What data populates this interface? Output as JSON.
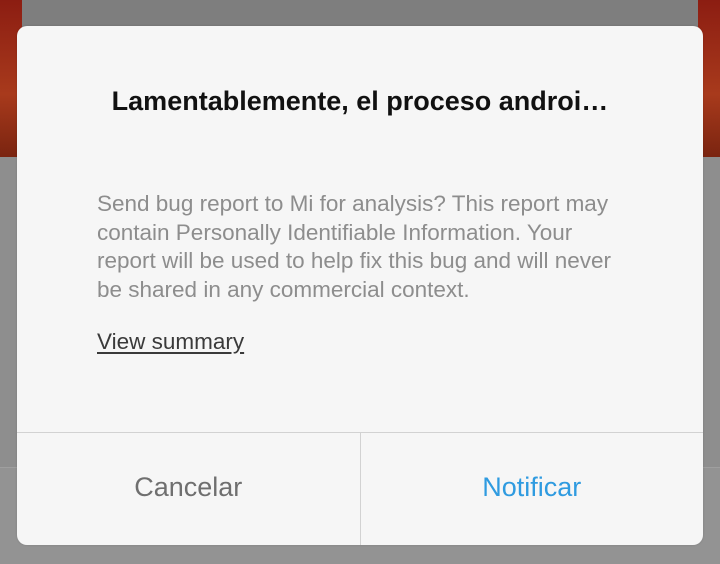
{
  "dialog": {
    "title": "Lamentablemente, el proceso androi…",
    "message": "Send bug report to Mi for analysis? This report may contain Personally Identifiable Information. Your report will be used to help fix this bug and will never be shared in any commercial context.",
    "view_summary_label": "View summary",
    "cancel_label": "Cancelar",
    "confirm_label": "Notificar"
  },
  "colors": {
    "confirm_accent": "#2f9be0",
    "cancel_text": "#6f6f6f",
    "message_text": "#8d8d8d",
    "dialog_background": "#f6f6f6",
    "scrim": "#8c8c8c"
  }
}
